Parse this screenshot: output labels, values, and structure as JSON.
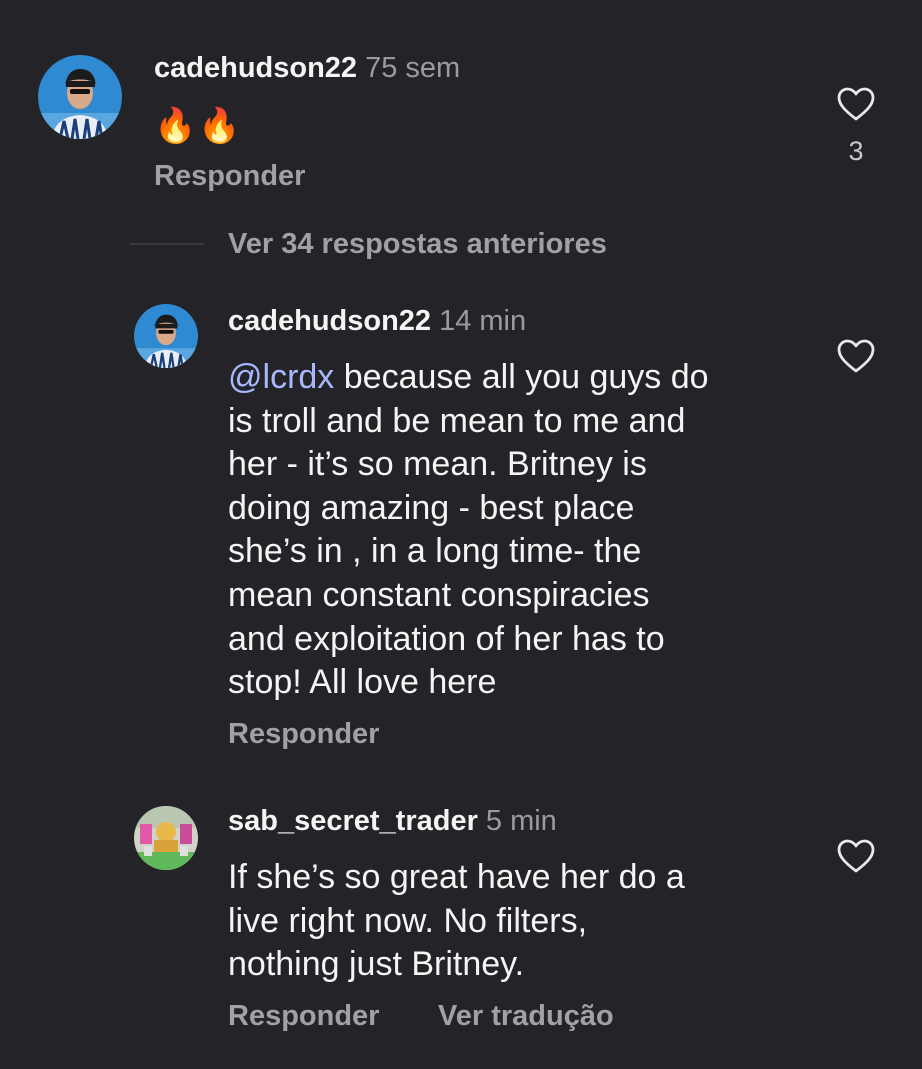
{
  "comments": [
    {
      "username": "cadehudson22",
      "time": "75 sem",
      "text": "🔥🔥",
      "reply_label": "Responder",
      "like_count": "3"
    },
    {
      "username": "cadehudson22",
      "time": "14 min",
      "mention": "@lcrdx",
      "text_after_mention": " because all you guys do\nis troll and be mean to me and\nher - it’s so mean. Britney is\ndoing amazing - best place\nshe’s in , in a long time- the\nmean constant conspiracies\nand exploitation of her has to\nstop! All love here",
      "reply_label": "Responder"
    },
    {
      "username": "sab_secret_trader",
      "time": "5 min",
      "text": "If she’s so great have her do a\nlive right now. No filters,\nnothing just Britney.",
      "reply_label": "Responder",
      "translate_label": "Ver tradução"
    }
  ],
  "view_replies_label": "Ver 34 respostas anteriores",
  "icons": {
    "like": "heart-outline-icon"
  },
  "colors": {
    "background": "#232328",
    "mention": "#a8b8ff",
    "muted": "#9a9aa0"
  }
}
